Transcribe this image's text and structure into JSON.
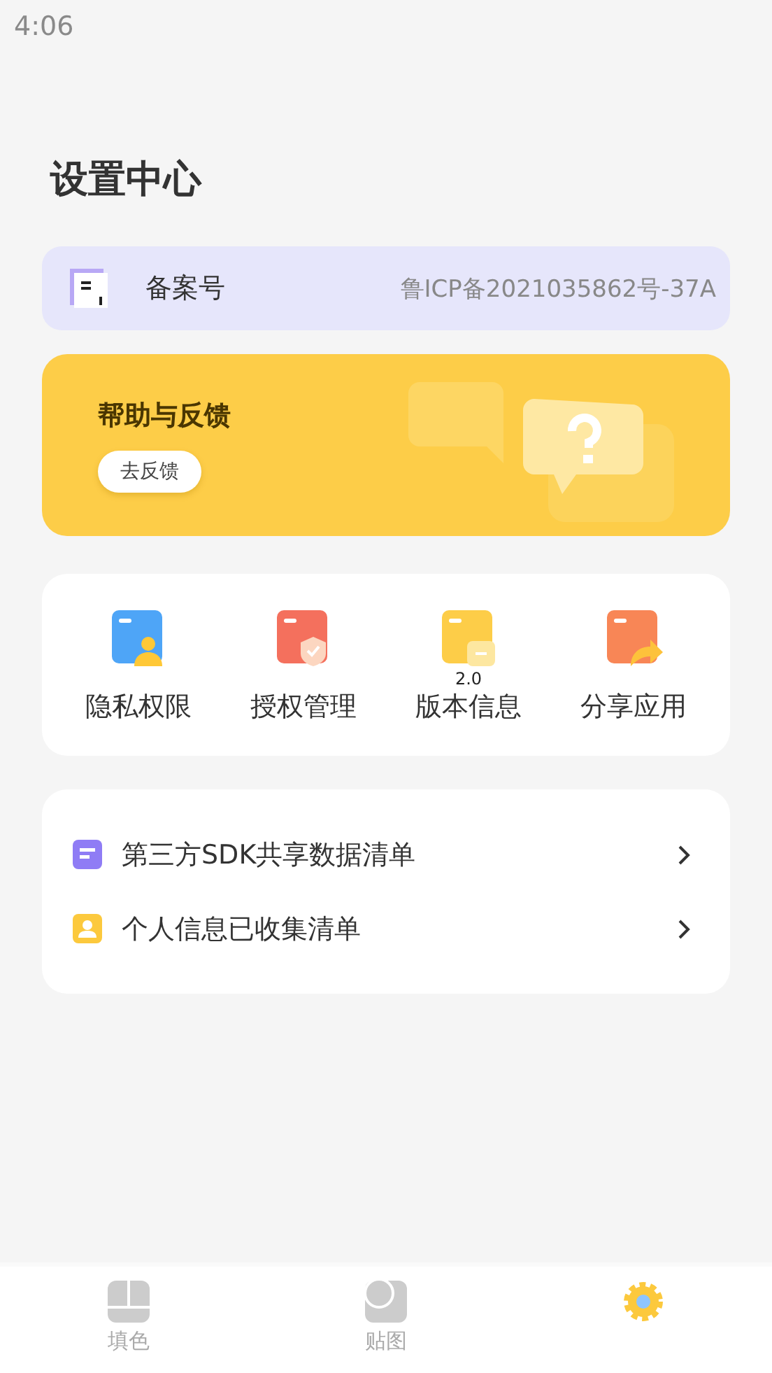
{
  "status_bar": {
    "time": "4:06"
  },
  "title": "设置中心",
  "record": {
    "label": "备案号",
    "value": "鲁ICP备2021035862号-37A"
  },
  "help_banner": {
    "title": "帮助与反馈",
    "button": "去反馈"
  },
  "shortcuts": [
    {
      "label": "隐私权限",
      "kind": "privacy"
    },
    {
      "label": "授权管理",
      "kind": "auth"
    },
    {
      "label": "版本信息",
      "kind": "version",
      "badge": "2.0"
    },
    {
      "label": "分享应用",
      "kind": "share"
    }
  ],
  "lists": [
    {
      "label": "第三方SDK共享数据清单",
      "kind": "sdk"
    },
    {
      "label": "个人信息已收集清单",
      "kind": "personal"
    }
  ],
  "tabs": [
    {
      "label": "填色",
      "kind": "fill",
      "selected": false
    },
    {
      "label": "贴图",
      "kind": "sticker",
      "selected": false
    },
    {
      "kind": "settings",
      "selected": true
    }
  ]
}
